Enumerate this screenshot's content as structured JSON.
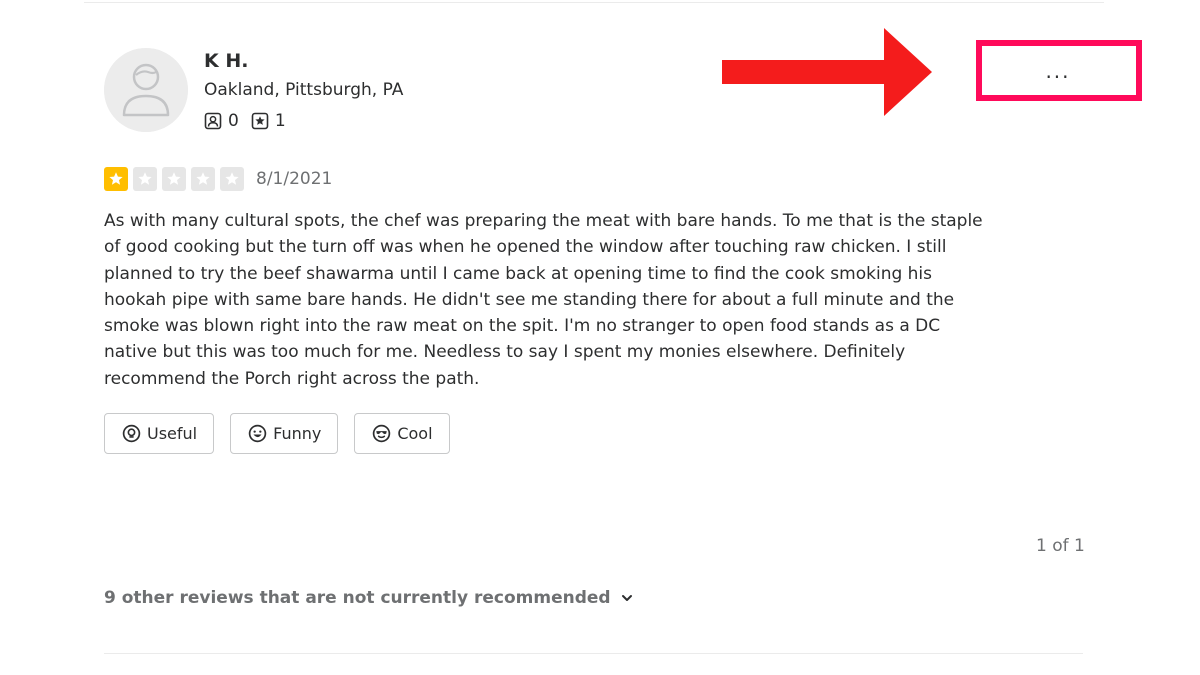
{
  "review": {
    "user": {
      "name": "K H.",
      "location": "Oakland, Pittsburgh, PA",
      "friends_count": "0",
      "reviews_count": "1",
      "avatar_icon": "default-user-avatar-icon",
      "friends_icon": "friends-icon",
      "reviews_icon": "reviews-star-icon"
    },
    "more_options_label": "...",
    "rating": 1,
    "rating_max": 5,
    "rating_color": "#ffbe00",
    "rating_empty_color": "#e6e6e6",
    "date": "8/1/2021",
    "text": "As with many cultural spots, the chef was preparing the meat with bare hands. To me that is the staple of good cooking but the turn off was when he opened the window after touching raw chicken. I still planned to try the beef shawarma until I came back at opening time to find the cook smoking his hookah pipe with same bare hands. He didn't see me standing there for about a full minute and the smoke was blown right into the raw meat on the spit. I'm no stranger to open food stands as a DC native but this was too much for me. Needless to say I spent my monies elsewhere. Definitely recommend the Porch right across the path.",
    "reactions": [
      {
        "label": "Useful",
        "icon": "lightbulb-icon"
      },
      {
        "label": "Funny",
        "icon": "smile-icon"
      },
      {
        "label": "Cool",
        "icon": "sunglasses-icon"
      }
    ]
  },
  "annotation": {
    "arrow_color": "#f41c1c",
    "highlight_color": "#ff0a5a"
  },
  "pagination": {
    "label": "1 of 1"
  },
  "not_recommended": {
    "label": "9 other reviews that are not currently recommended",
    "icon": "chevron-down-icon"
  }
}
